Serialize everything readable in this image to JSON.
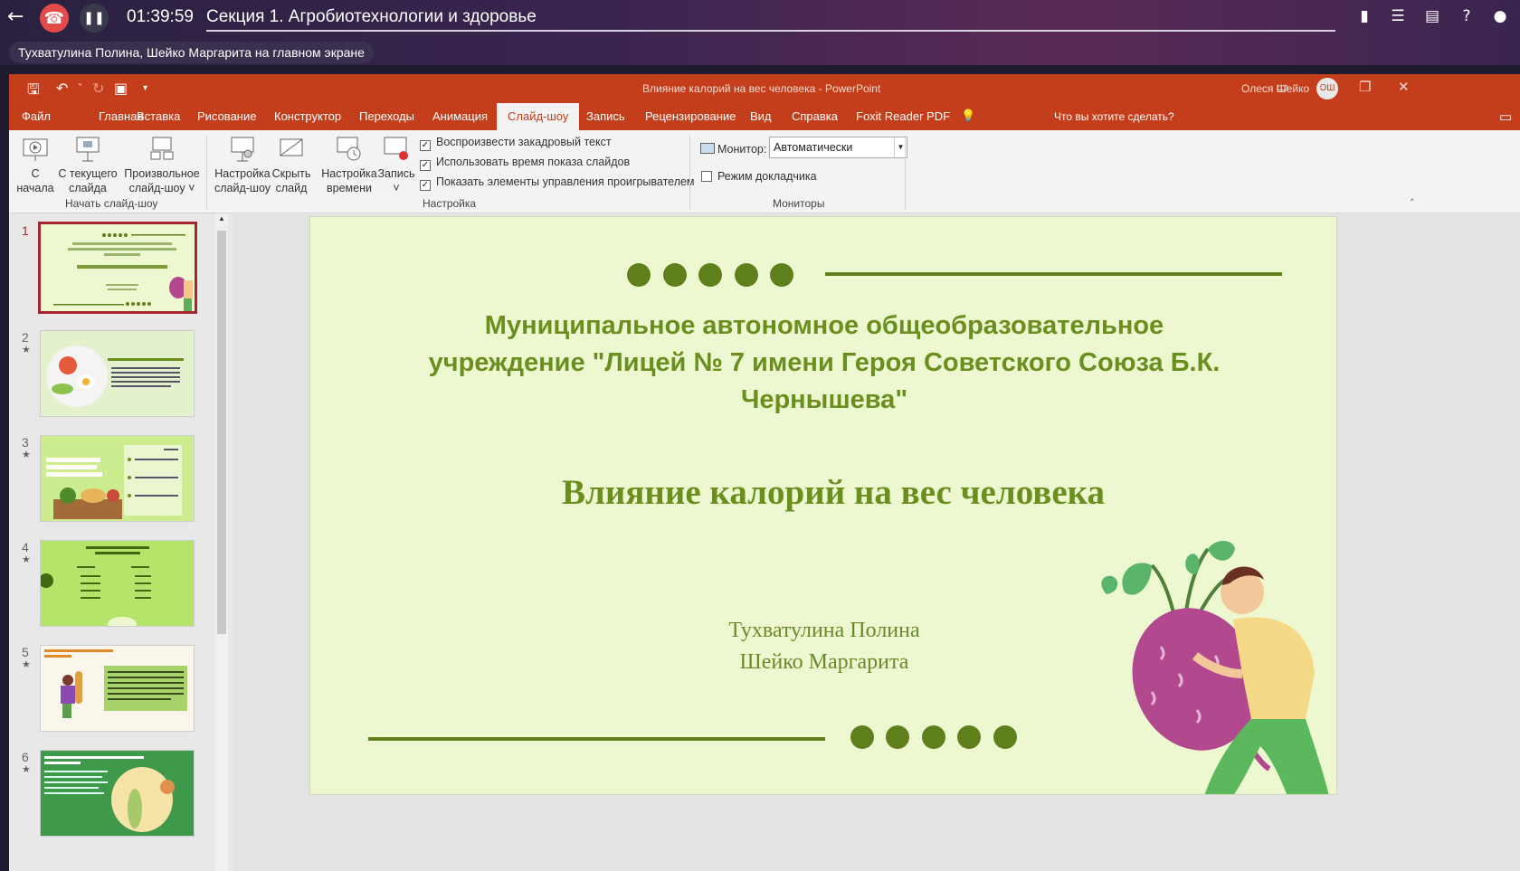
{
  "call": {
    "timer": "01:39:59",
    "title": "Секция 1. Агробиотехнологии и здоровье",
    "screen_label": "Тухватулина Полина, Шейко Маргарита на главном экране"
  },
  "window": {
    "title": "Влияние калорий на вес человека  -  PowerPoint",
    "user": "Олеся Шейко",
    "avatar": "ОШ"
  },
  "tabs": [
    "Файл",
    "Главная",
    "Вставка",
    "Рисование",
    "Конструктор",
    "Переходы",
    "Анимация",
    "Слайд-шоу",
    "Запись",
    "Рецензирование",
    "Вид",
    "Справка",
    "Foxit Reader PDF"
  ],
  "active_tab": "Слайд-шоу",
  "tell_me": "Что вы хотите сделать?",
  "ribbon": {
    "from_start_1": "С",
    "from_start_2": "начала",
    "from_current_1": "С текущего",
    "from_current_2": "слайда",
    "custom_1": "Произвольное",
    "custom_2": "слайд-шоу ˅",
    "group_start": "Начать слайд-шоу",
    "setup_1": "Настройка",
    "setup_2": "слайд-шоу",
    "hide_1": "Скрыть",
    "hide_2": "слайд",
    "timing_1": "Настройка",
    "timing_2": "времени",
    "record_1": "Запись",
    "record_2": "˅",
    "chk_narration": "Воспроизвести закадровый текст",
    "chk_timings": "Использовать время показа слайдов",
    "chk_controls": "Показать элементы управления проигрывателем",
    "group_setup": "Настройка",
    "monitor_label": "Монитор:",
    "monitor_value": "Автоматически",
    "presenter_view": "Режим докладчика",
    "group_monitors": "Мониторы"
  },
  "slides": [
    "1",
    "2",
    "3",
    "4",
    "5",
    "6"
  ],
  "slide": {
    "school_1": "Муниципальное автономное общеобразовательное",
    "school_2": "учреждение \"Лицей № 7 имени Героя Советского Союза Б.К.",
    "school_3": "Чернышева\"",
    "title": "Влияние калорий на вес человека",
    "author_1": "Тухватулина Полина",
    "author_2": "Шейко Маргарита"
  },
  "colors": {
    "ppt_red": "#c43e1c",
    "slide_bg": "#eef8d0",
    "slide_green": "#6a8f1e"
  }
}
